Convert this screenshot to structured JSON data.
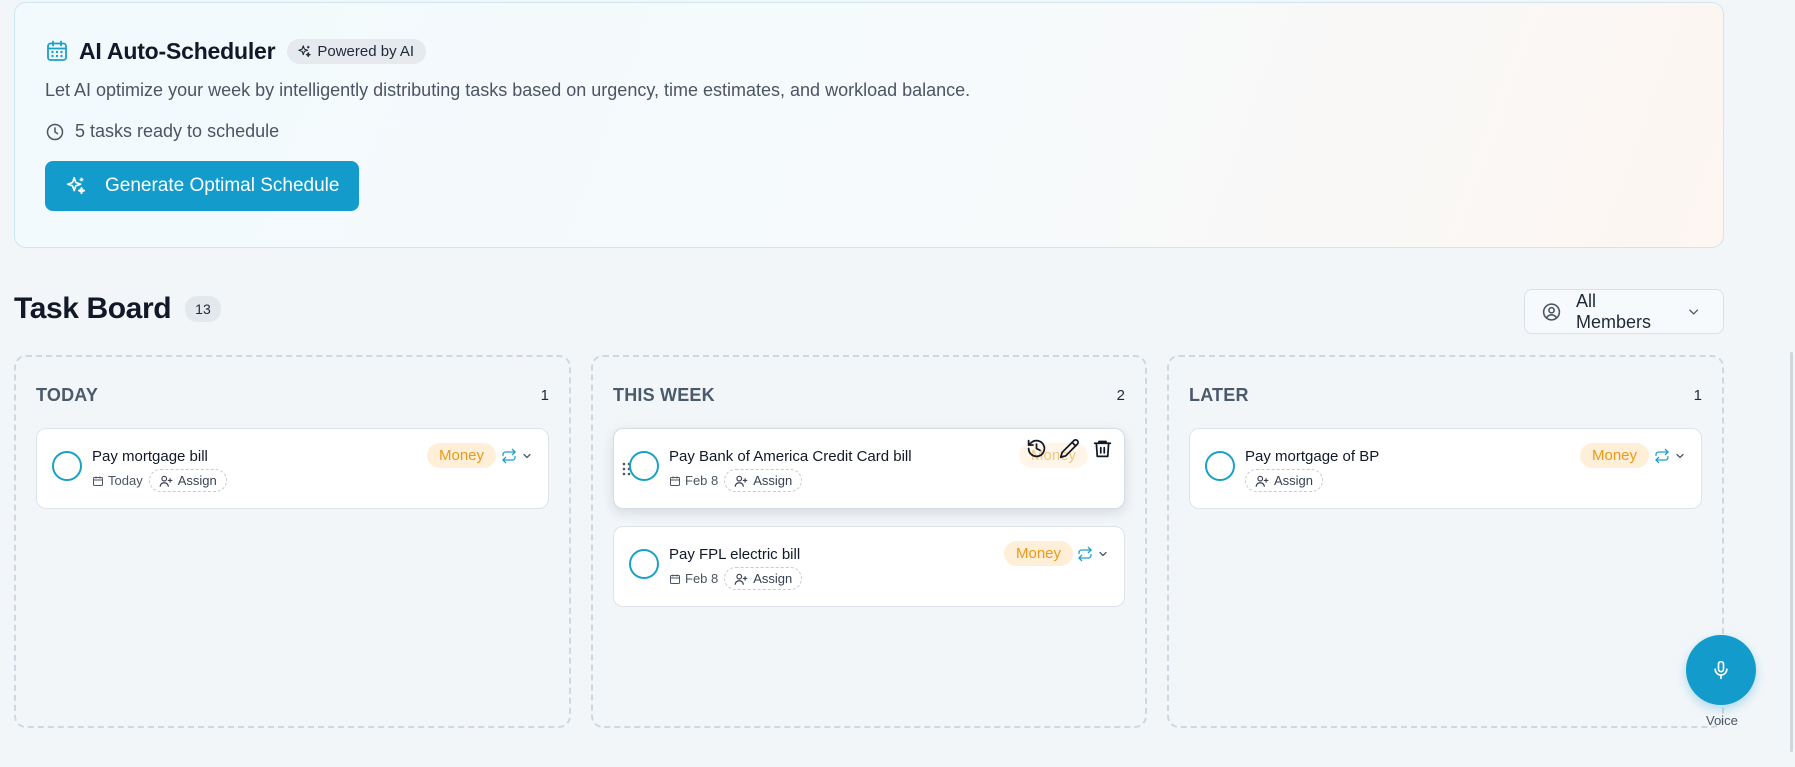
{
  "scheduler": {
    "title": "AI Auto-Scheduler",
    "badge": "Powered by AI",
    "description": "Let AI optimize your week by intelligently distributing tasks based on urgency, time estimates, and workload balance.",
    "ready_text": "5 tasks ready to schedule",
    "button_label": "Generate Optimal Schedule"
  },
  "board": {
    "title": "Task Board",
    "count": "13",
    "filter": {
      "selected": "All Members"
    }
  },
  "columns": [
    {
      "name": "TODAY",
      "count": "1",
      "tasks": [
        {
          "title": "Pay mortgage bill",
          "date": "Today",
          "assign": "Assign",
          "tag": "Money"
        }
      ]
    },
    {
      "name": "THIS WEEK",
      "count": "2",
      "tasks": [
        {
          "title": "Pay Bank of America Credit Card bill",
          "date": "Feb 8",
          "assign": "Assign",
          "tag": "Money"
        },
        {
          "title": "Pay FPL electric bill",
          "date": "Feb 8",
          "assign": "Assign",
          "tag": "Money"
        }
      ]
    },
    {
      "name": "LATER",
      "count": "1",
      "tasks": [
        {
          "title": "Pay mortgage of BP",
          "assign": "Assign",
          "tag": "Money"
        }
      ]
    }
  ],
  "voice": {
    "label": "Voice"
  },
  "colors": {
    "accent": "#139ccb",
    "tag_bg": "#ffefd8",
    "tag_text": "#ea9a1a"
  },
  "icons": [
    "calendar-icon",
    "sparkles-icon",
    "clock-icon",
    "user-circle-icon",
    "chevron-down-icon",
    "repeat-icon",
    "user-plus-icon",
    "history-icon",
    "pencil-icon",
    "trash-icon",
    "grip-icon",
    "microphone-icon"
  ]
}
